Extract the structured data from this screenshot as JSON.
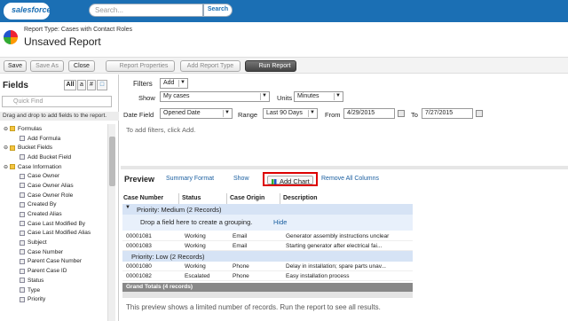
{
  "header": {
    "logo": "salesforce",
    "search_placeholder": "Search...",
    "search_button": "Search"
  },
  "report": {
    "type_label": "Report Type: Cases with Contact Roles",
    "title": "Unsaved Report"
  },
  "toolbar": {
    "save": "Save",
    "save_as": "Save As",
    "close": "Close",
    "report_properties": "Report Properties",
    "add_report_type": "Add Report Type",
    "run_report": "Run Report"
  },
  "fields": {
    "title": "Fields",
    "tabs": [
      "All",
      "a",
      "#",
      "□"
    ],
    "quick_find": "Quick Find",
    "hint": "Drag and drop to add fields to the report.",
    "tree": [
      {
        "label": "Formulas",
        "kind": "folder",
        "indent": 0
      },
      {
        "label": "Add Formula",
        "kind": "field",
        "indent": 1
      },
      {
        "label": "Bucket Fields",
        "kind": "folder",
        "indent": 0
      },
      {
        "label": "Add Bucket Field",
        "kind": "field",
        "indent": 1
      },
      {
        "label": "Case Information",
        "kind": "folder",
        "indent": 0
      },
      {
        "label": "Case Owner",
        "kind": "field",
        "indent": 1
      },
      {
        "label": "Case Owner Alias",
        "kind": "field",
        "indent": 1
      },
      {
        "label": "Case Owner Role",
        "kind": "field",
        "indent": 1
      },
      {
        "label": "Created By",
        "kind": "field",
        "indent": 1
      },
      {
        "label": "Created Alias",
        "kind": "field",
        "indent": 1
      },
      {
        "label": "Case Last Modified By",
        "kind": "field",
        "indent": 1
      },
      {
        "label": "Case Last Modified Alias",
        "kind": "field",
        "indent": 1
      },
      {
        "label": "Subject",
        "kind": "field",
        "indent": 1
      },
      {
        "label": "Case Number",
        "kind": "field",
        "indent": 1
      },
      {
        "label": "Parent Case Number",
        "kind": "field",
        "indent": 1
      },
      {
        "label": "Parent Case ID",
        "kind": "field",
        "indent": 1
      },
      {
        "label": "Status",
        "kind": "field",
        "indent": 1
      },
      {
        "label": "Type",
        "kind": "field",
        "indent": 1
      },
      {
        "label": "Priority",
        "kind": "field",
        "indent": 1
      }
    ]
  },
  "filters": {
    "label": "Filters",
    "add": "Add",
    "show_label": "Show",
    "show_value": "My cases",
    "units_label": "Units",
    "units_value": "Minutes",
    "date_field_label": "Date Field",
    "date_field_value": "Opened Date",
    "range_label": "Range",
    "range_value": "Last 90 Days",
    "from_label": "From",
    "from_value": "4/29/2015",
    "to_label": "To",
    "to_value": "7/27/2015",
    "empty_text": "To add filters, click Add."
  },
  "preview": {
    "title": "Preview",
    "summary_format": "Summary Format",
    "show": "Show",
    "add_chart": "Add Chart",
    "remove_all": "Remove All Columns",
    "columns": [
      "Case Number",
      "Status",
      "Case Origin",
      "Description"
    ],
    "group1": "Priority: Medium (2 Records)",
    "drop_text": "Drop a field here to create a grouping.",
    "hide": "Hide",
    "rows1": [
      [
        "00001081",
        "Working",
        "Email",
        "Generator assembly instructions unclear"
      ],
      [
        "00001083",
        "Working",
        "Email",
        "Starting generator after electrical fai..."
      ]
    ],
    "group2": "Priority: Low (2 Records)",
    "rows2": [
      [
        "00001080",
        "Working",
        "Phone",
        "Delay in installation; spare parts unav..."
      ],
      [
        "00001082",
        "Escalated",
        "Phone",
        "Easy installation process"
      ]
    ],
    "grand_total": "Grand Totals (4 records)",
    "note": "This preview shows a limited number of records. Run the report to see all results."
  }
}
